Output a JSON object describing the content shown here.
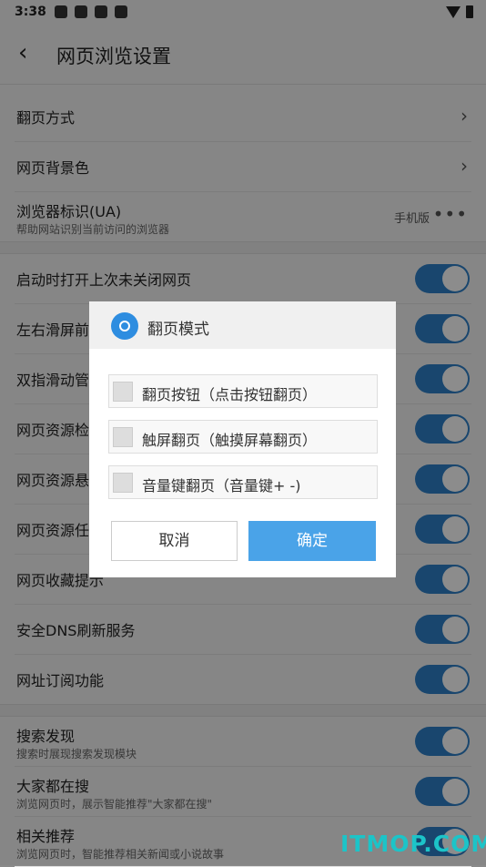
{
  "status": {
    "time": "3:38"
  },
  "header": {
    "title": "网页浏览设置"
  },
  "settings": {
    "page_turn_mode": "翻页方式",
    "bg_color": "网页背景色",
    "ua_label": "浏览器标识(UA)",
    "ua_sub": "帮助网站识别当前访问的浏览器",
    "ua_value": "手机版",
    "toggles": [
      "启动时打开上次未关闭网页",
      "左右滑屏前进后退",
      "双指滑动管理窗口",
      "网页资源检测",
      "网页资源悬浮提示",
      "网页资源任务",
      "网页收藏提示",
      "安全DNS刷新服务",
      "网址订阅功能"
    ],
    "toggle_visible": [
      "启动时打开上次未关闭网页",
      "左右滑屏前",
      "双指滑动管",
      "网页资源检",
      "网页资源悬",
      "网页资源任",
      "网页收藏提示",
      "安全DNS刷新服务",
      "网址订阅功能"
    ],
    "search_find": "搜索发现",
    "search_find_sub": "搜索时展现搜索发现模块",
    "hot_search": "大家都在搜",
    "hot_search_sub": "浏览网页时，展示智能推荐\"大家都在搜\"",
    "related": "相关推荐",
    "related_sub": "浏览网页时，智能推荐相关新闻或小说故事"
  },
  "dialog": {
    "title": "翻页模式",
    "options": [
      "翻页按钮（点击按钮翻页）",
      "触屏翻页（触摸屏幕翻页）",
      "音量键翻页（音量键+ -)"
    ],
    "cancel": "取消",
    "ok": "确定"
  },
  "watermark": "ITMOP.COM",
  "colors": {
    "toggle_on": "#2f80c8",
    "ok_button": "#4aa3e8",
    "watermark": "#1cc4c8"
  }
}
